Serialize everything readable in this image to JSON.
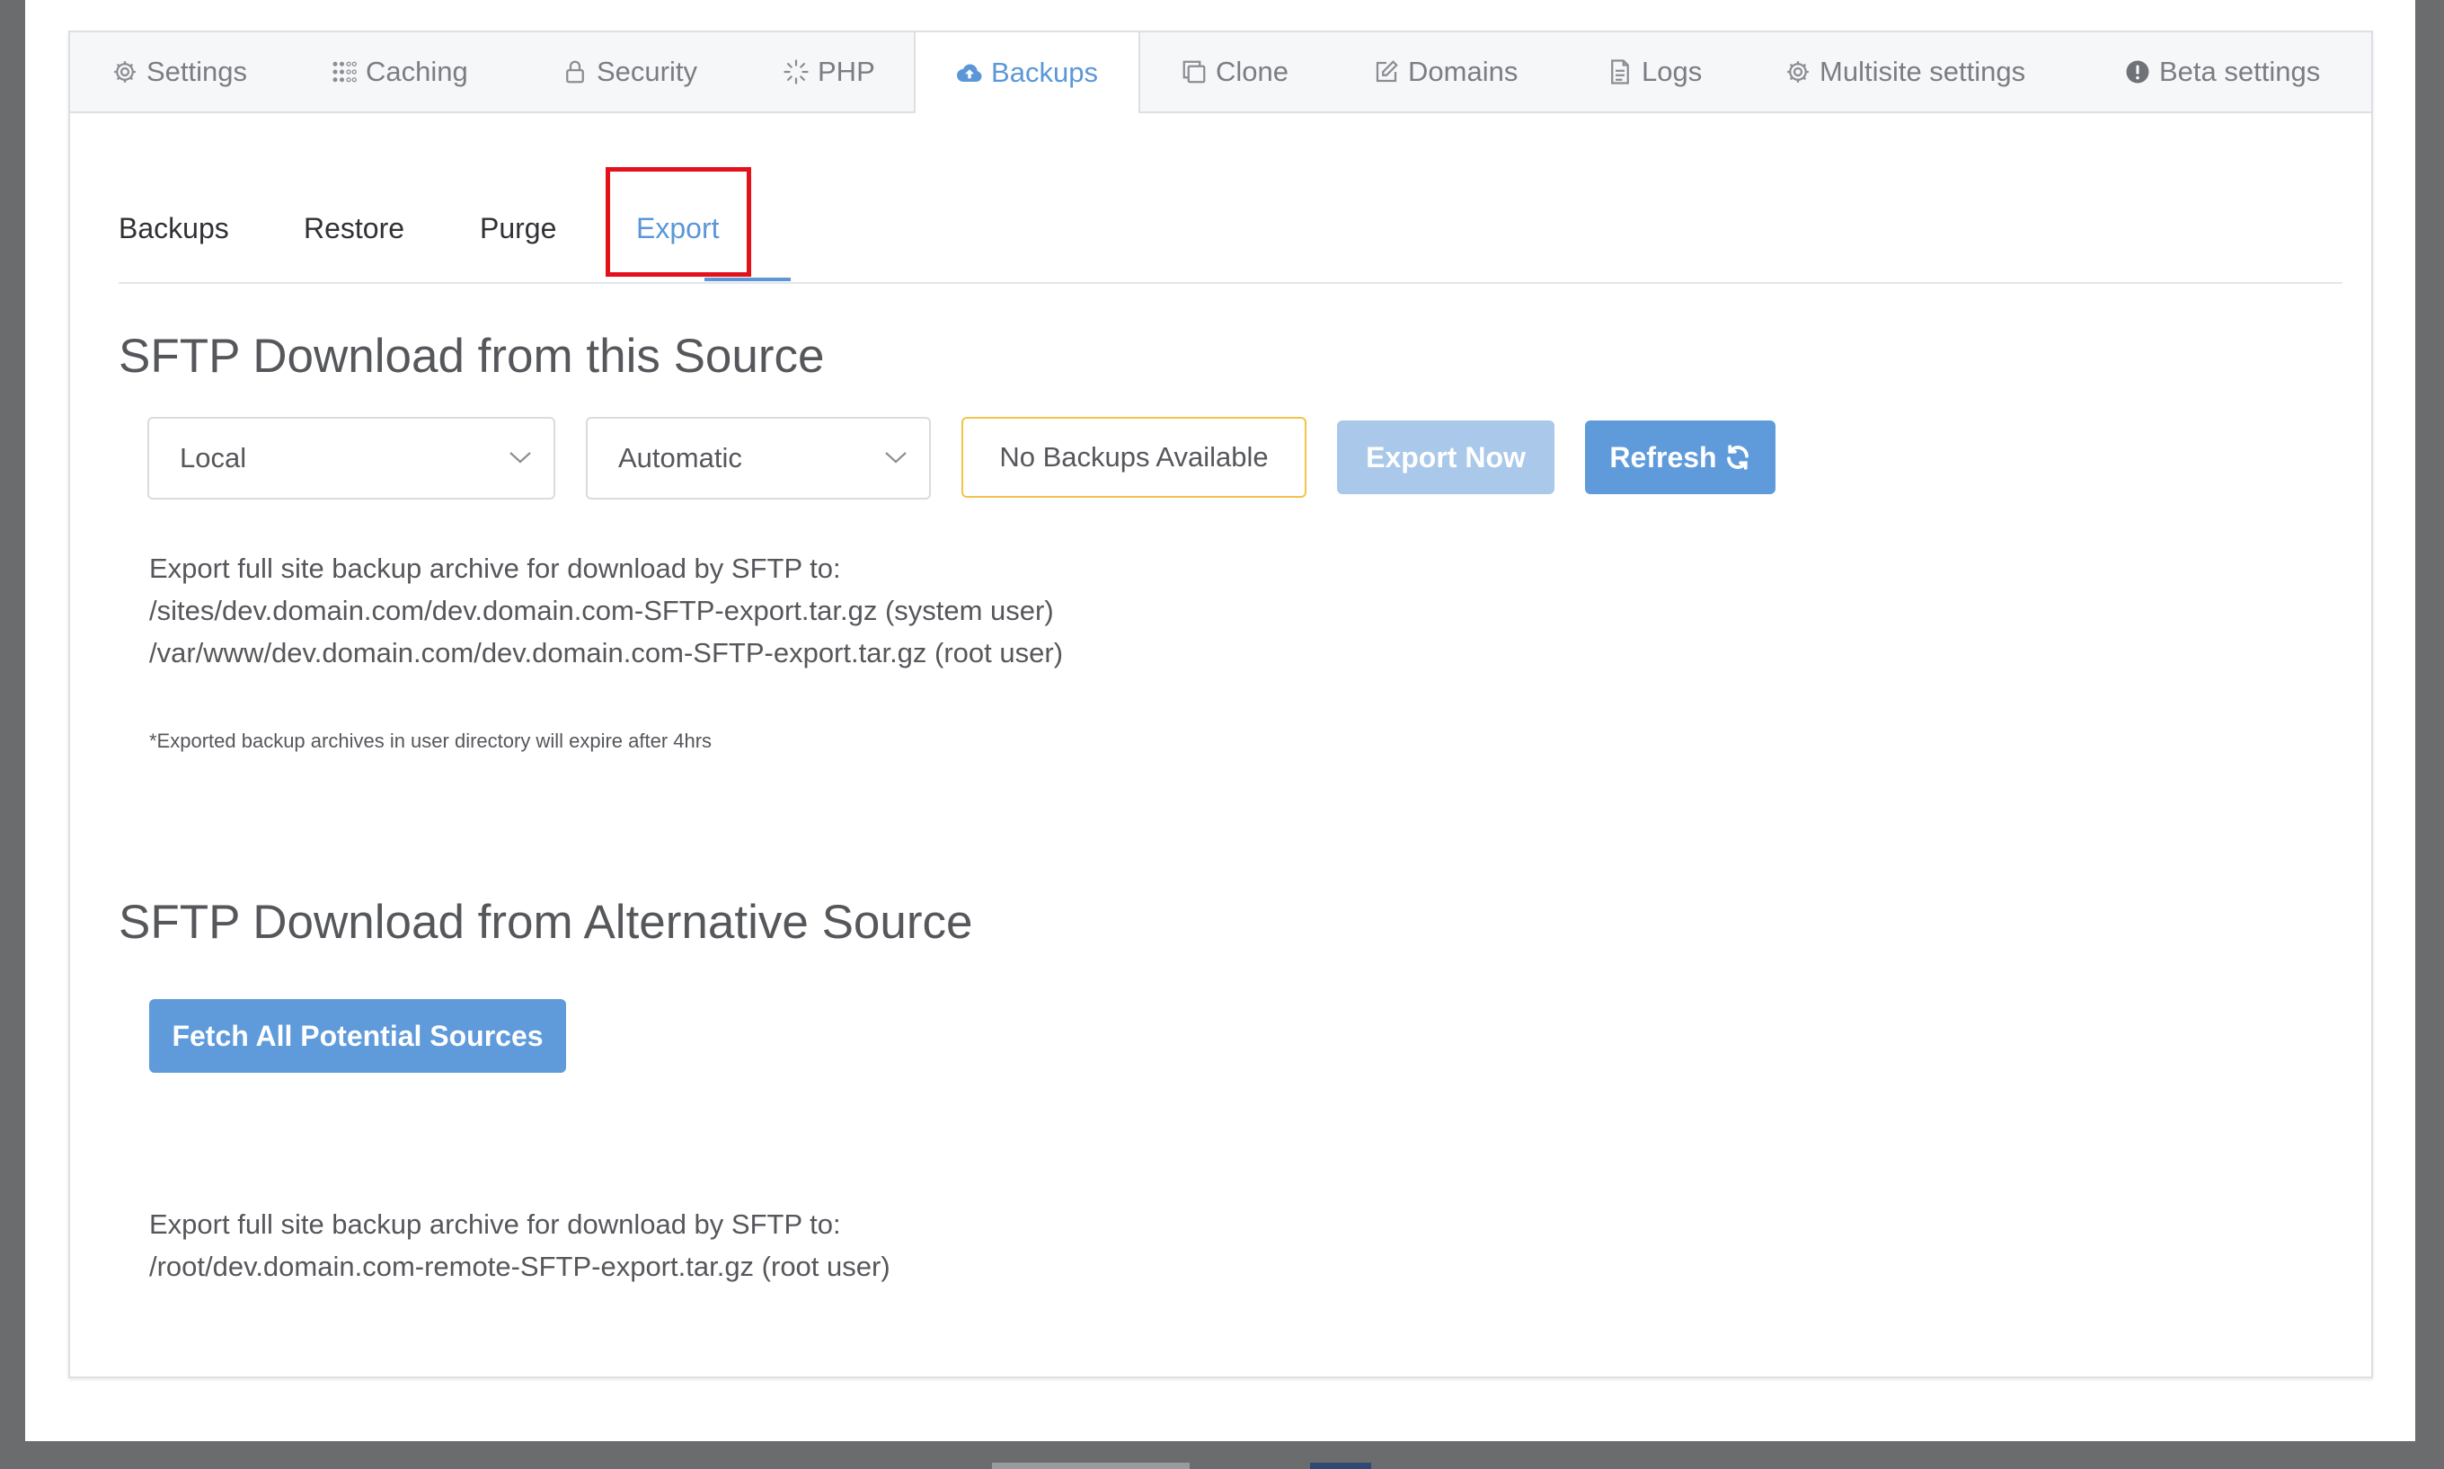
{
  "tabs": [
    {
      "label": "Settings",
      "icon": "gear-icon"
    },
    {
      "label": "Caching",
      "icon": "dots-grid-icon"
    },
    {
      "label": "Security",
      "icon": "lock-icon"
    },
    {
      "label": "PHP",
      "icon": "spinner-icon"
    },
    {
      "label": "Backups",
      "icon": "cloud-upload-icon",
      "active": true
    },
    {
      "label": "Clone",
      "icon": "copy-icon"
    },
    {
      "label": "Domains",
      "icon": "edit-icon"
    },
    {
      "label": "Logs",
      "icon": "file-icon"
    },
    {
      "label": "Multisite settings",
      "icon": "gear-icon"
    },
    {
      "label": "Beta settings",
      "icon": "alert-circle-icon"
    }
  ],
  "subtabs": [
    {
      "label": "Backups"
    },
    {
      "label": "Restore"
    },
    {
      "label": "Purge"
    },
    {
      "label": "Export",
      "active": true
    }
  ],
  "section1": {
    "heading": "SFTP Download from this Source",
    "source_select": "Local",
    "mode_select": "Automatic",
    "status_badge": "No Backups Available",
    "export_button": "Export Now",
    "refresh_button": "Refresh",
    "description": [
      "Export full site backup archive for download by SFTP to:",
      "/sites/dev.domain.com/dev.domain.com-SFTP-export.tar.gz (system user)",
      "/var/www/dev.domain.com/dev.domain.com-SFTP-export.tar.gz (root user)"
    ],
    "note": "*Exported backup archives in user directory will expire after 4hrs"
  },
  "section2": {
    "heading": "SFTP Download from Alternative Source",
    "fetch_button": "Fetch All Potential Sources",
    "description": [
      "Export full site backup archive for download by SFTP to:",
      "/root/dev.domain.com-remote-SFTP-export.tar.gz (root user)"
    ]
  },
  "colors": {
    "accent": "#5b97d8",
    "button": "#5f9bdb",
    "button_disabled": "#a9c8ea",
    "badge_border": "#f3c34a",
    "highlight": "#e3111b"
  }
}
